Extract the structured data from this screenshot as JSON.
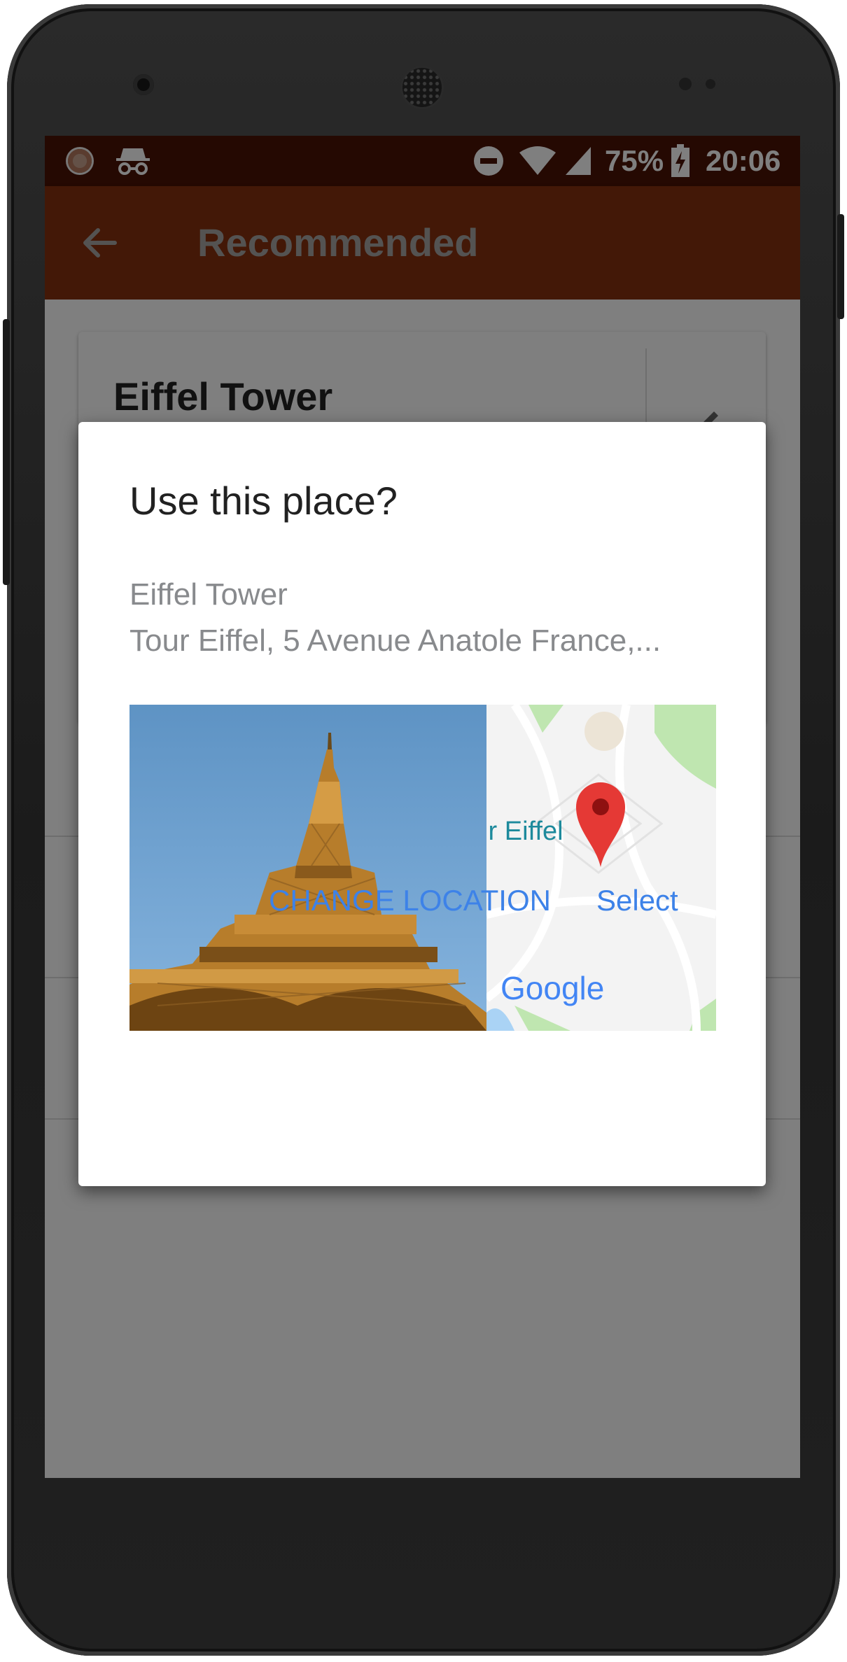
{
  "status_bar": {
    "battery": "75%",
    "time": "20:06"
  },
  "app_bar": {
    "title": "Recommended"
  },
  "background_card": {
    "title": "Eiffel Tower"
  },
  "dialog": {
    "title": "Use this place?",
    "place_name": "Eiffel Tower",
    "address": "Tour Eiffel, 5 Avenue Anatole France,...",
    "map_label": "ır Eiffel",
    "map_brand": "Google",
    "change_location_label": "CHANGE LOCATION",
    "select_label": "Select"
  },
  "colors": {
    "status_bar": "#4a1204",
    "app_bar": "#86300f",
    "accent_button": "#3d82e8",
    "map_pin": "#e53935"
  }
}
